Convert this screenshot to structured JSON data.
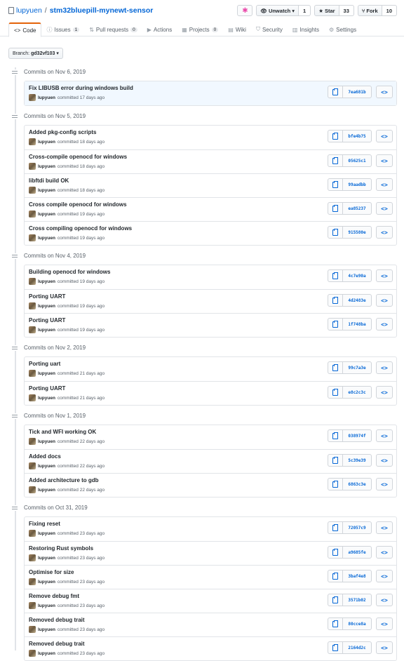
{
  "repo": {
    "owner": "lupyuen",
    "separator": "/",
    "name": "stm32bluepill-mynewt-sensor"
  },
  "actions": {
    "sponsor_icon": "✱",
    "unwatch_label": "Unwatch ▾",
    "unwatch_count": "1",
    "star_label": "Star",
    "star_count": "33",
    "fork_label": "Fork",
    "fork_count": "10"
  },
  "tabs": [
    {
      "icon": "<>",
      "label": "Code",
      "badge": ""
    },
    {
      "icon": "ⓘ",
      "label": "Issues",
      "badge": "1"
    },
    {
      "icon": "⇅",
      "label": "Pull requests",
      "badge": "0"
    },
    {
      "icon": "▶",
      "label": "Actions",
      "badge": ""
    },
    {
      "icon": "▦",
      "label": "Projects",
      "badge": "0"
    },
    {
      "icon": "▤",
      "label": "Wiki",
      "badge": ""
    },
    {
      "icon": "⛉",
      "label": "Security",
      "badge": ""
    },
    {
      "icon": "▥",
      "label": "Insights",
      "badge": ""
    },
    {
      "icon": "⚙",
      "label": "Settings",
      "badge": ""
    }
  ],
  "branch": {
    "prefix": "Branch:",
    "name": "gd32vf103",
    "caret": "▾"
  },
  "groups": [
    {
      "date": "Commits on Nov 6, 2019",
      "commits": [
        {
          "message": "Fix LIBUSB error during windows build",
          "author": "lupyuen",
          "when": "committed 17 days ago",
          "sha": "7ea681b"
        }
      ]
    },
    {
      "date": "Commits on Nov 5, 2019",
      "commits": [
        {
          "message": "Added pkg-config scripts",
          "author": "lupyuen",
          "when": "committed 18 days ago",
          "sha": "bfe4b75"
        },
        {
          "message": "Cross-compile openocd for windows",
          "author": "lupyuen",
          "when": "committed 18 days ago",
          "sha": "05625c1"
        },
        {
          "message": "libftdi build OK",
          "author": "lupyuen",
          "when": "committed 18 days ago",
          "sha": "99aadbb"
        },
        {
          "message": "Cross compile openocd for windows",
          "author": "lupyuen",
          "when": "committed 19 days ago",
          "sha": "ea85237"
        },
        {
          "message": "Cross compiling openocd for windows",
          "author": "lupyuen",
          "when": "committed 19 days ago",
          "sha": "915580e"
        }
      ]
    },
    {
      "date": "Commits on Nov 4, 2019",
      "commits": [
        {
          "message": "Building openocd for windows",
          "author": "lupyuen",
          "when": "committed 19 days ago",
          "sha": "4c7e90a"
        },
        {
          "message": "Porting UART",
          "author": "lupyuen",
          "when": "committed 19 days ago",
          "sha": "4d2483e"
        },
        {
          "message": "Porting UART",
          "author": "lupyuen",
          "when": "committed 19 days ago",
          "sha": "1f748ba"
        }
      ]
    },
    {
      "date": "Commits on Nov 2, 2019",
      "commits": [
        {
          "message": "Porting uart",
          "author": "lupyuen",
          "when": "committed 21 days ago",
          "sha": "99c7a3e"
        },
        {
          "message": "Porting UART",
          "author": "lupyuen",
          "when": "committed 21 days ago",
          "sha": "e8c2c3c"
        }
      ]
    },
    {
      "date": "Commits on Nov 1, 2019",
      "commits": [
        {
          "message": "Tick and WFI working OK",
          "author": "lupyuen",
          "when": "committed 22 days ago",
          "sha": "038974f"
        },
        {
          "message": "Added docs",
          "author": "lupyuen",
          "when": "committed 22 days ago",
          "sha": "5c39e39"
        },
        {
          "message": "Added architecture to gdb",
          "author": "lupyuen",
          "when": "committed 22 days ago",
          "sha": "6863c3e"
        }
      ]
    },
    {
      "date": "Commits on Oct 31, 2019",
      "commits": [
        {
          "message": "Fixing reset",
          "author": "lupyuen",
          "when": "committed 23 days ago",
          "sha": "72057c9"
        },
        {
          "message": "Restoring Rust symbols",
          "author": "lupyuen",
          "when": "committed 23 days ago",
          "sha": "a9685fe"
        },
        {
          "message": "Optimise for size",
          "author": "lupyuen",
          "when": "committed 23 days ago",
          "sha": "3baf4e8"
        },
        {
          "message": "Remove debug fmt",
          "author": "lupyuen",
          "when": "committed 23 days ago",
          "sha": "3571b02"
        },
        {
          "message": "Removed debug trait",
          "author": "lupyuen",
          "when": "committed 23 days ago",
          "sha": "80cce8a"
        },
        {
          "message": "Removed debug trait",
          "author": "lupyuen",
          "when": "committed 23 days ago",
          "sha": "2164d2c"
        }
      ]
    }
  ],
  "browse_icon": "<>",
  "colors": {
    "link": "#0366d6",
    "tab_accent": "#e36209",
    "highlight_row": "#f1f8ff"
  }
}
